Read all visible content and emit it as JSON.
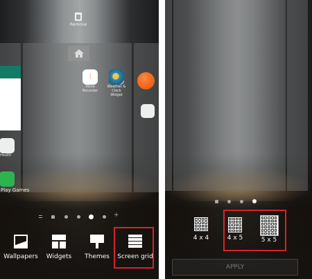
{
  "left": {
    "remove_label": "Remove",
    "apps": [
      {
        "label": "Voice Recorder"
      },
      {
        "label": "Weather & Clock Widget"
      },
      {
        "label": "Health"
      },
      {
        "label": "Play Games"
      }
    ],
    "options": [
      {
        "label": "Wallpapers"
      },
      {
        "label": "Widgets"
      },
      {
        "label": "Themes"
      },
      {
        "label": "Screen grid"
      }
    ]
  },
  "right": {
    "grid_options": [
      {
        "label": "4 x 4"
      },
      {
        "label": "4 x 5"
      },
      {
        "label": "5 x 5"
      }
    ],
    "apply_label": "APPLY"
  },
  "colors": {
    "highlight": "#d4242a"
  }
}
